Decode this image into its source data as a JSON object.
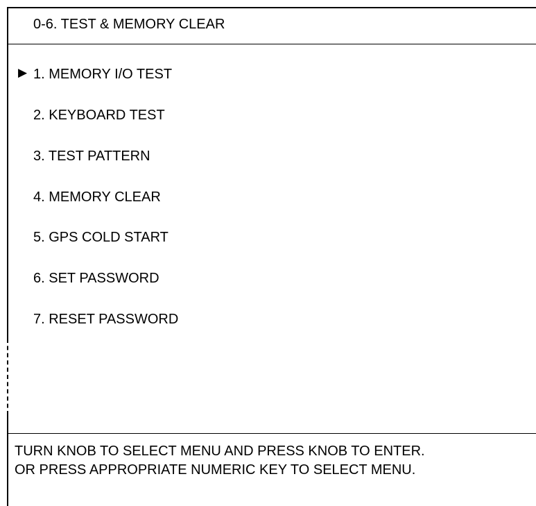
{
  "header": {
    "title": "0-6. TEST & MEMORY CLEAR"
  },
  "menu": {
    "selected_index": 0,
    "cursor_glyph": "▶",
    "items": [
      {
        "label": "1. MEMORY I/O TEST"
      },
      {
        "label": "2. KEYBOARD TEST"
      },
      {
        "label": "3. TEST PATTERN"
      },
      {
        "label": "4. MEMORY CLEAR"
      },
      {
        "label": "5. GPS COLD START"
      },
      {
        "label": "6. SET PASSWORD"
      },
      {
        "label": "7. RESET PASSWORD"
      }
    ]
  },
  "footer": {
    "line1": "TURN KNOB TO SELECT MENU AND PRESS KNOB TO ENTER.",
    "line2": "OR PRESS APPROPRIATE NUMERIC KEY TO SELECT MENU."
  }
}
